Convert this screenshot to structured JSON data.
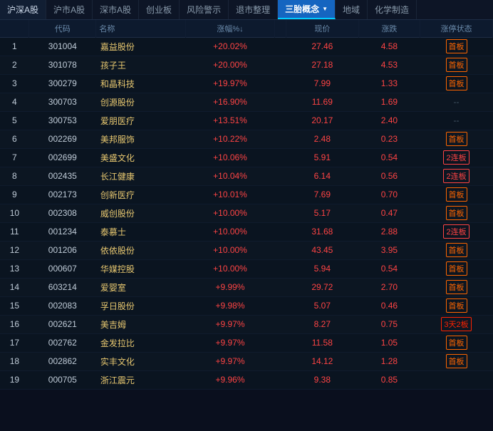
{
  "nav": {
    "tabs": [
      {
        "label": "沪深A股",
        "active": false
      },
      {
        "label": "沪市A股",
        "active": false
      },
      {
        "label": "深市A股",
        "active": false
      },
      {
        "label": "创业板",
        "active": false
      },
      {
        "label": "风险警示",
        "active": false
      },
      {
        "label": "退市整理",
        "active": false
      },
      {
        "label": "三胎概念",
        "active": true,
        "dropdown": true
      },
      {
        "label": "地域",
        "active": false
      },
      {
        "label": "化学制造",
        "active": false
      }
    ]
  },
  "columns": [
    "",
    "代码",
    "名称",
    "涨幅%↓",
    "",
    "现价",
    "涨跌",
    "涨停状态"
  ],
  "rows": [
    {
      "num": 1,
      "code": "301004",
      "name": "嘉益股份",
      "change": "+20.02%",
      "price": "27.46",
      "diff": "4.58",
      "status": "首板",
      "status_type": "first"
    },
    {
      "num": 2,
      "code": "301078",
      "name": "孩子王",
      "change": "+20.00%",
      "price": "27.18",
      "diff": "4.53",
      "status": "首板",
      "status_type": "first"
    },
    {
      "num": 3,
      "code": "300279",
      "name": "和晶科技",
      "change": "+19.97%",
      "price": "7.99",
      "diff": "1.33",
      "status": "首板",
      "status_type": "first"
    },
    {
      "num": 4,
      "code": "300703",
      "name": "创源股份",
      "change": "+16.90%",
      "price": "11.69",
      "diff": "1.69",
      "status": "--",
      "status_type": "dash"
    },
    {
      "num": 5,
      "code": "300753",
      "name": "爱朋医疗",
      "change": "+13.51%",
      "price": "20.17",
      "diff": "2.40",
      "status": "--",
      "status_type": "dash"
    },
    {
      "num": 6,
      "code": "002269",
      "name": "美邦服饰",
      "change": "+10.22%",
      "price": "2.48",
      "diff": "0.23",
      "status": "首板",
      "status_type": "first"
    },
    {
      "num": 7,
      "code": "002699",
      "name": "美盛文化",
      "change": "+10.06%",
      "price": "5.91",
      "diff": "0.54",
      "status": "2连板",
      "status_type": "2ban"
    },
    {
      "num": 8,
      "code": "002435",
      "name": "长江健康",
      "change": "+10.04%",
      "price": "6.14",
      "diff": "0.56",
      "status": "2连板",
      "status_type": "2ban"
    },
    {
      "num": 9,
      "code": "002173",
      "name": "创新医疗",
      "change": "+10.01%",
      "price": "7.69",
      "diff": "0.70",
      "status": "首板",
      "status_type": "first"
    },
    {
      "num": 10,
      "code": "002308",
      "name": "威创股份",
      "change": "+10.00%",
      "price": "5.17",
      "diff": "0.47",
      "status": "首板",
      "status_type": "first"
    },
    {
      "num": 11,
      "code": "001234",
      "name": "泰慕士",
      "change": "+10.00%",
      "price": "31.68",
      "diff": "2.88",
      "status": "2连板",
      "status_type": "2ban"
    },
    {
      "num": 12,
      "code": "001206",
      "name": "依依股份",
      "change": "+10.00%",
      "price": "43.45",
      "diff": "3.95",
      "status": "首板",
      "status_type": "first"
    },
    {
      "num": 13,
      "code": "000607",
      "name": "华媒控股",
      "change": "+10.00%",
      "price": "5.94",
      "diff": "0.54",
      "status": "首板",
      "status_type": "first"
    },
    {
      "num": 14,
      "code": "603214",
      "name": "爱婴室",
      "change": "+9.99%",
      "price": "29.72",
      "diff": "2.70",
      "status": "首板",
      "status_type": "first"
    },
    {
      "num": 15,
      "code": "002083",
      "name": "孚日股份",
      "change": "+9.98%",
      "price": "5.07",
      "diff": "0.46",
      "status": "首板",
      "status_type": "first"
    },
    {
      "num": 16,
      "code": "002621",
      "name": "美吉姆",
      "change": "+9.97%",
      "price": "8.27",
      "diff": "0.75",
      "status": "3天2板",
      "status_type": "3ban"
    },
    {
      "num": 17,
      "code": "002762",
      "name": "金发拉比",
      "change": "+9.97%",
      "price": "11.58",
      "diff": "1.05",
      "status": "首板",
      "status_type": "first"
    },
    {
      "num": 18,
      "code": "002862",
      "name": "实丰文化",
      "change": "+9.97%",
      "price": "14.12",
      "diff": "1.28",
      "status": "首板",
      "status_type": "first"
    },
    {
      "num": 19,
      "code": "000705",
      "name": "浙江震元",
      "change": "+9.96%",
      "price": "9.38",
      "diff": "0.85",
      "status": "",
      "status_type": "none"
    }
  ],
  "accent": "#00ccff",
  "rise_color": "#ff4444",
  "fall_color": "#33cc66"
}
